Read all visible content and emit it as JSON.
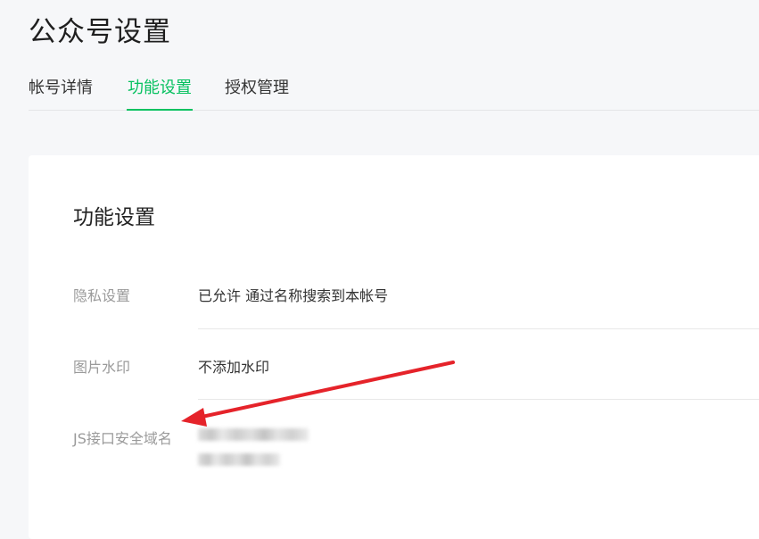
{
  "page": {
    "title": "公众号设置"
  },
  "tabs": [
    {
      "label": "帐号详情",
      "active": false
    },
    {
      "label": "功能设置",
      "active": true
    },
    {
      "label": "授权管理",
      "active": false
    }
  ],
  "card": {
    "title": "功能设置",
    "rows": [
      {
        "label": "隐私设置",
        "value": "已允许 通过名称搜索到本帐号"
      },
      {
        "label": "图片水印",
        "value": "不添加水印"
      },
      {
        "label": "JS接口安全域名",
        "value": ""
      }
    ]
  },
  "colors": {
    "accent": "#07c160",
    "annotation_arrow": "#e5232a",
    "background": "#f6f7f9"
  }
}
